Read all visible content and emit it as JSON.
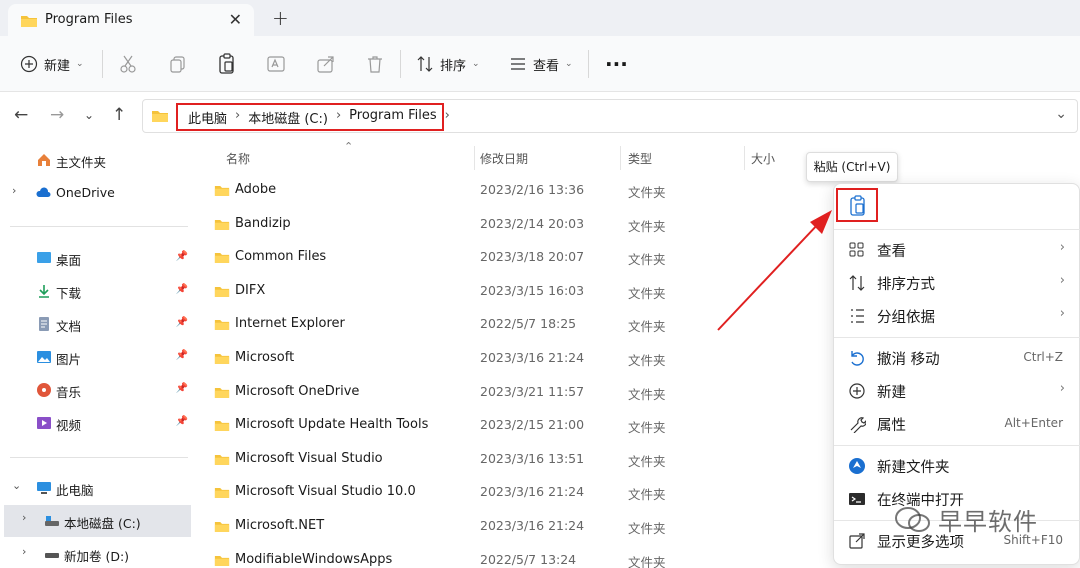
{
  "window": {
    "tab_title": "Program Files",
    "tab_close": "✕",
    "tab_add": "+"
  },
  "toolbar": {
    "new_label": "新建",
    "sort_label": "排序",
    "view_label": "查看",
    "more_label": "···"
  },
  "address": {
    "breadcrumbs": [
      "此电脑",
      "本地磁盘 (C:)",
      "Program Files"
    ],
    "separator": "›"
  },
  "sidebar": {
    "home": "主文件夹",
    "onedrive": "OneDrive",
    "quick": [
      {
        "label": "桌面",
        "icon": "desktop-icon"
      },
      {
        "label": "下载",
        "icon": "download-icon"
      },
      {
        "label": "文档",
        "icon": "document-icon"
      },
      {
        "label": "图片",
        "icon": "pictures-icon"
      },
      {
        "label": "音乐",
        "icon": "music-icon"
      },
      {
        "label": "视频",
        "icon": "video-icon"
      }
    ],
    "this_pc": "此电脑",
    "drives": [
      {
        "label": "本地磁盘 (C:)"
      },
      {
        "label": "新加卷 (D:)"
      }
    ]
  },
  "columns": {
    "name": "名称",
    "date": "修改日期",
    "type": "类型",
    "size": "大小"
  },
  "files": [
    {
      "name": "Adobe",
      "date": "2023/2/16 13:36",
      "type": "文件夹"
    },
    {
      "name": "Bandizip",
      "date": "2023/2/14 20:03",
      "type": "文件夹"
    },
    {
      "name": "Common Files",
      "date": "2023/3/18 20:07",
      "type": "文件夹"
    },
    {
      "name": "DIFX",
      "date": "2023/3/15 16:03",
      "type": "文件夹"
    },
    {
      "name": "Internet Explorer",
      "date": "2022/5/7 18:25",
      "type": "文件夹"
    },
    {
      "name": "Microsoft",
      "date": "2023/3/16 21:24",
      "type": "文件夹"
    },
    {
      "name": "Microsoft OneDrive",
      "date": "2023/3/21 11:57",
      "type": "文件夹"
    },
    {
      "name": "Microsoft Update Health Tools",
      "date": "2023/2/15 21:00",
      "type": "文件夹"
    },
    {
      "name": "Microsoft Visual Studio",
      "date": "2023/3/16 13:51",
      "type": "文件夹"
    },
    {
      "name": "Microsoft Visual Studio 10.0",
      "date": "2023/3/16 21:24",
      "type": "文件夹"
    },
    {
      "name": "Microsoft.NET",
      "date": "2023/3/16 21:24",
      "type": "文件夹"
    },
    {
      "name": "ModifiableWindowsApps",
      "date": "2022/5/7 13:24",
      "type": "文件夹"
    }
  ],
  "tooltip": "粘贴 (Ctrl+V)",
  "context_menu": {
    "items": [
      {
        "label": "查看",
        "shortcut": "",
        "submenu": true
      },
      {
        "label": "排序方式",
        "shortcut": "",
        "submenu": true
      },
      {
        "label": "分组依据",
        "shortcut": "",
        "submenu": true
      },
      {
        "label": "撤消 移动",
        "shortcut": "Ctrl+Z",
        "submenu": false
      },
      {
        "label": "新建",
        "shortcut": "",
        "submenu": true
      },
      {
        "label": "属性",
        "shortcut": "Alt+Enter",
        "submenu": false
      },
      {
        "label": "新建文件夹",
        "shortcut": "",
        "submenu": false
      },
      {
        "label": "在终端中打开",
        "shortcut": "",
        "submenu": false
      },
      {
        "label": "显示更多选项",
        "shortcut": "Shift+F10",
        "submenu": false
      }
    ]
  },
  "watermark": "早早软件",
  "colors": {
    "highlight_red": "#e02020",
    "folder_yellow": "#f5c33b",
    "accent_blue": "#1a6fd0"
  }
}
